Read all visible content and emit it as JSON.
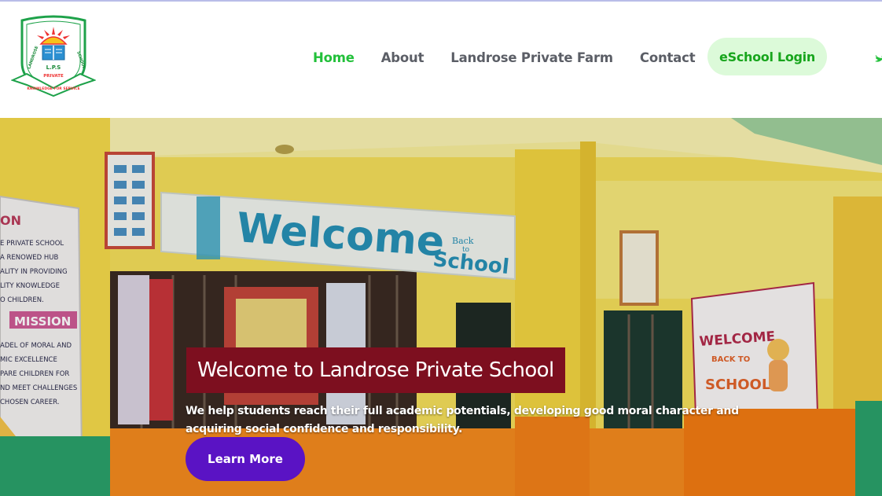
{
  "brand": {
    "logo_initials": "L.P.S",
    "logo_ring_text_left": "LANDROSE",
    "logo_ring_text_right": "SCHOOL",
    "logo_banner_text": "PRIVATE",
    "logo_motto": "KNOWLEDGE FOR SERVICE"
  },
  "nav": {
    "items": [
      {
        "label": "Home",
        "active": true
      },
      {
        "label": "About",
        "active": false
      },
      {
        "label": "Landrose Private Farm",
        "active": false
      },
      {
        "label": "Contact",
        "active": false
      }
    ],
    "login_label": "eSchool Login",
    "social_icon": "twitter-icon"
  },
  "hero": {
    "title": "Welcome to Landrose Private School",
    "description": "We help students reach their full academic potentials, developing good moral character and acquiring social confidence and responsibility.",
    "cta_label": "Learn More",
    "photo": {
      "sign_main": "Welcome",
      "sign_small_1": "Back",
      "sign_small_2": "to",
      "sign_school": "School",
      "poster_lines": [
        "ON",
        "E PRIVATE SCHOOL",
        "A RENOWED HUB",
        "ALITY IN PROVIDING",
        "LITY KNOWLEDGE",
        "O CHILDREN."
      ],
      "mission_label": "MISSION",
      "mission_lines": [
        "ADEL OF MORAL AND",
        "MIC EXCELLENCE",
        "PARE CHILDREN FOR",
        "ND MEET CHALLENGES",
        "CHOSEN CAREER."
      ],
      "banner_welcome": "WELCOME",
      "banner_back": "BACK TO",
      "banner_school": "SCHOOL"
    }
  },
  "colors": {
    "active_nav": "#22c03a",
    "nav_text": "#5b5e66",
    "login_bg": "#dcfad9",
    "login_text": "#17a51c",
    "title_bg": "#7d0f1f",
    "cta_bg": "#5a13c4"
  }
}
